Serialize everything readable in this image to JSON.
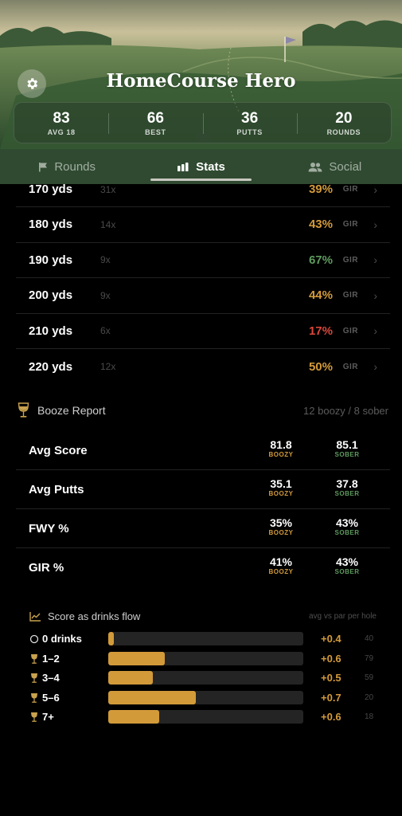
{
  "app": {
    "title": "HomeCourse Hero"
  },
  "header_stats": [
    {
      "value": "83",
      "label": "AVG 18"
    },
    {
      "value": "66",
      "label": "BEST"
    },
    {
      "value": "36",
      "label": "PUTTS"
    },
    {
      "value": "20",
      "label": "ROUNDS"
    }
  ],
  "tabs": [
    {
      "label": "Rounds",
      "icon": "flag-icon"
    },
    {
      "label": "Stats",
      "icon": "bar-chart-icon",
      "active": true
    },
    {
      "label": "Social",
      "icon": "people-icon"
    }
  ],
  "distances": [
    {
      "yds": "170 yds",
      "count": "31x",
      "pct": "39%",
      "color": "#d39a3a",
      "gir": "GIR"
    },
    {
      "yds": "180 yds",
      "count": "14x",
      "pct": "43%",
      "color": "#d39a3a",
      "gir": "GIR"
    },
    {
      "yds": "190 yds",
      "count": "9x",
      "pct": "67%",
      "color": "#5e9b5e",
      "gir": "GIR"
    },
    {
      "yds": "200 yds",
      "count": "9x",
      "pct": "44%",
      "color": "#d39a3a",
      "gir": "GIR"
    },
    {
      "yds": "210 yds",
      "count": "6x",
      "pct": "17%",
      "color": "#d9473a",
      "gir": "GIR"
    },
    {
      "yds": "220 yds",
      "count": "12x",
      "pct": "50%",
      "color": "#d39a3a",
      "gir": "GIR"
    }
  ],
  "booze_report": {
    "title": "Booze Report",
    "meta": "12 boozy / 8 sober",
    "boozy_tag": "BOOZY",
    "sober_tag": "SOBER",
    "rows": [
      {
        "label": "Avg Score",
        "boozy": "81.8",
        "sober": "85.1"
      },
      {
        "label": "Avg Putts",
        "boozy": "35.1",
        "sober": "37.8"
      },
      {
        "label": "FWY %",
        "boozy": "35%",
        "sober": "43%"
      },
      {
        "label": "GIR %",
        "boozy": "41%",
        "sober": "43%"
      }
    ]
  },
  "drinks_flow": {
    "title": "Score as drinks flow",
    "meta": "avg vs par per hole",
    "rows": [
      {
        "label": "0 drinks",
        "icon": "circle-icon",
        "fill": 0.03,
        "delta": "+0.4",
        "n": "40"
      },
      {
        "label": "1–2",
        "icon": "wine-glass-icon",
        "fill": 0.29,
        "delta": "+0.6",
        "n": "79"
      },
      {
        "label": "3–4",
        "icon": "wine-glass-icon",
        "fill": 0.23,
        "delta": "+0.5",
        "n": "59"
      },
      {
        "label": "5–6",
        "icon": "wine-glass-icon",
        "fill": 0.45,
        "delta": "+0.7",
        "n": "20"
      },
      {
        "label": "7+",
        "icon": "wine-glass-icon",
        "fill": 0.26,
        "delta": "+0.6",
        "n": "18"
      }
    ]
  },
  "colors": {
    "accent_gold": "#d39a3a",
    "good_green": "#5e9b5e",
    "bad_red": "#d9473a"
  }
}
